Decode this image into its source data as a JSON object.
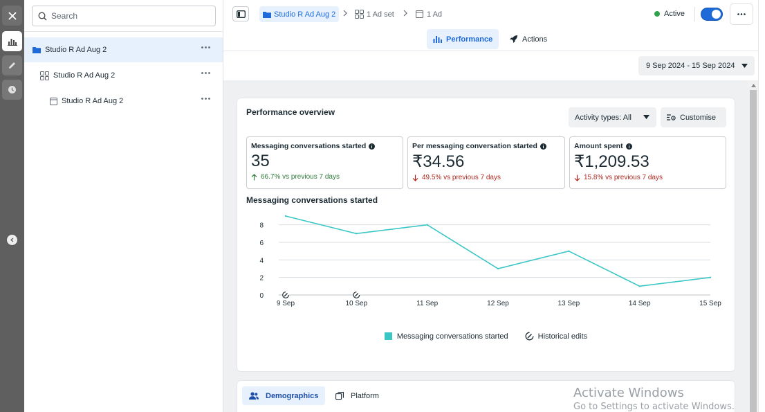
{
  "sidebar_search": {
    "placeholder": "Search"
  },
  "tree": {
    "items": [
      {
        "label": "Studio R Ad Aug 2",
        "level": "campaign"
      },
      {
        "label": "Studio R Ad Aug 2",
        "level": "ad-set"
      },
      {
        "label": "Studio R Ad Aug 2",
        "level": "ad"
      }
    ]
  },
  "breadcrumb": {
    "current": "Studio R Ad Aug 2",
    "ad_sets": "1 Ad set",
    "ads": "1 Ad"
  },
  "status": {
    "label": "Active",
    "toggle_on": true
  },
  "tabs": {
    "performance": "Performance",
    "actions": "Actions"
  },
  "date_range": "9 Sep 2024 - 15 Sep 2024",
  "overview": {
    "title": "Performance overview",
    "activity_types": "Activity types: All",
    "customise": "Customise",
    "metrics": [
      {
        "title": "Messaging conversations started",
        "value": "35",
        "change": "66.7% vs previous 7 days",
        "direction": "up"
      },
      {
        "title": "Per messaging conversation started",
        "value": "₹34.56",
        "change": "49.5% vs previous 7 days",
        "direction": "down"
      },
      {
        "title": "Amount spent",
        "value": "₹1,209.53",
        "change": "15.8% vs previous 7 days",
        "direction": "down"
      }
    ],
    "chart_heading": "Messaging conversations started"
  },
  "chart_data": {
    "type": "line",
    "categories": [
      "9 Sep",
      "10 Sep",
      "11 Sep",
      "12 Sep",
      "13 Sep",
      "14 Sep",
      "15 Sep"
    ],
    "series": [
      {
        "name": "Messaging conversations started",
        "values": [
          9,
          7,
          8,
          3,
          5,
          1,
          2
        ],
        "color": "#3bc6c6"
      }
    ],
    "yticks": [
      0,
      2,
      4,
      6,
      8
    ],
    "ylim": [
      0,
      9
    ],
    "historical_edits_at": [
      "9 Sep",
      "10 Sep"
    ],
    "legend": [
      "Messaging conversations started",
      "Historical edits"
    ],
    "legend_position": "bottom",
    "grid": true
  },
  "breakdown_tabs": {
    "demographics": "Demographics",
    "platform": "Platform"
  },
  "watermark": {
    "line1": "Activate Windows",
    "line2": "Go to Settings to activate Windows."
  },
  "colors": {
    "accent": "#1d6ad8",
    "series": "#3bc6c6",
    "active": "#31a24c"
  }
}
